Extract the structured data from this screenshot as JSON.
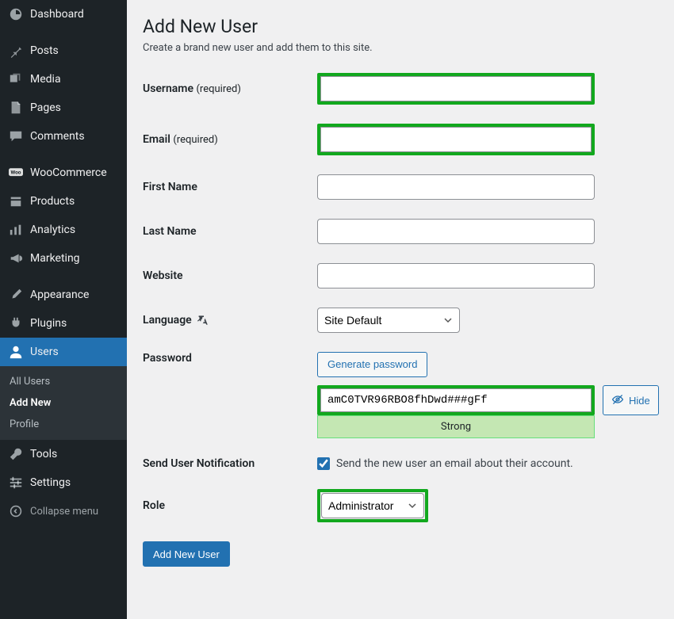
{
  "sidebar": {
    "items": [
      {
        "label": "Dashboard"
      },
      {
        "label": "Posts"
      },
      {
        "label": "Media"
      },
      {
        "label": "Pages"
      },
      {
        "label": "Comments"
      },
      {
        "label": "WooCommerce"
      },
      {
        "label": "Products"
      },
      {
        "label": "Analytics"
      },
      {
        "label": "Marketing"
      },
      {
        "label": "Appearance"
      },
      {
        "label": "Plugins"
      },
      {
        "label": "Users"
      },
      {
        "label": "Tools"
      },
      {
        "label": "Settings"
      }
    ],
    "submenu": {
      "all_users": "All Users",
      "add_new": "Add New",
      "profile": "Profile"
    },
    "collapse": "Collapse menu"
  },
  "page": {
    "title": "Add New User",
    "description": "Create a brand new user and add them to this site."
  },
  "form": {
    "username_label": "Username",
    "required_suffix": "(required)",
    "email_label": "Email",
    "first_name_label": "First Name",
    "last_name_label": "Last Name",
    "website_label": "Website",
    "language_label": "Language",
    "language_value": "Site Default",
    "password_label": "Password",
    "generate_password_label": "Generate password",
    "password_value": "amC0TVR96RBO8fhDwd###gFf",
    "hide_label": "Hide",
    "strength_label": "Strong",
    "send_notification_label": "Send User Notification",
    "send_notification_text": "Send the new user an email about their account.",
    "role_label": "Role",
    "role_value": "Administrator",
    "submit_label": "Add New User"
  },
  "colors": {
    "highlight_green": "#12a81e",
    "primary_blue": "#2271b1"
  }
}
